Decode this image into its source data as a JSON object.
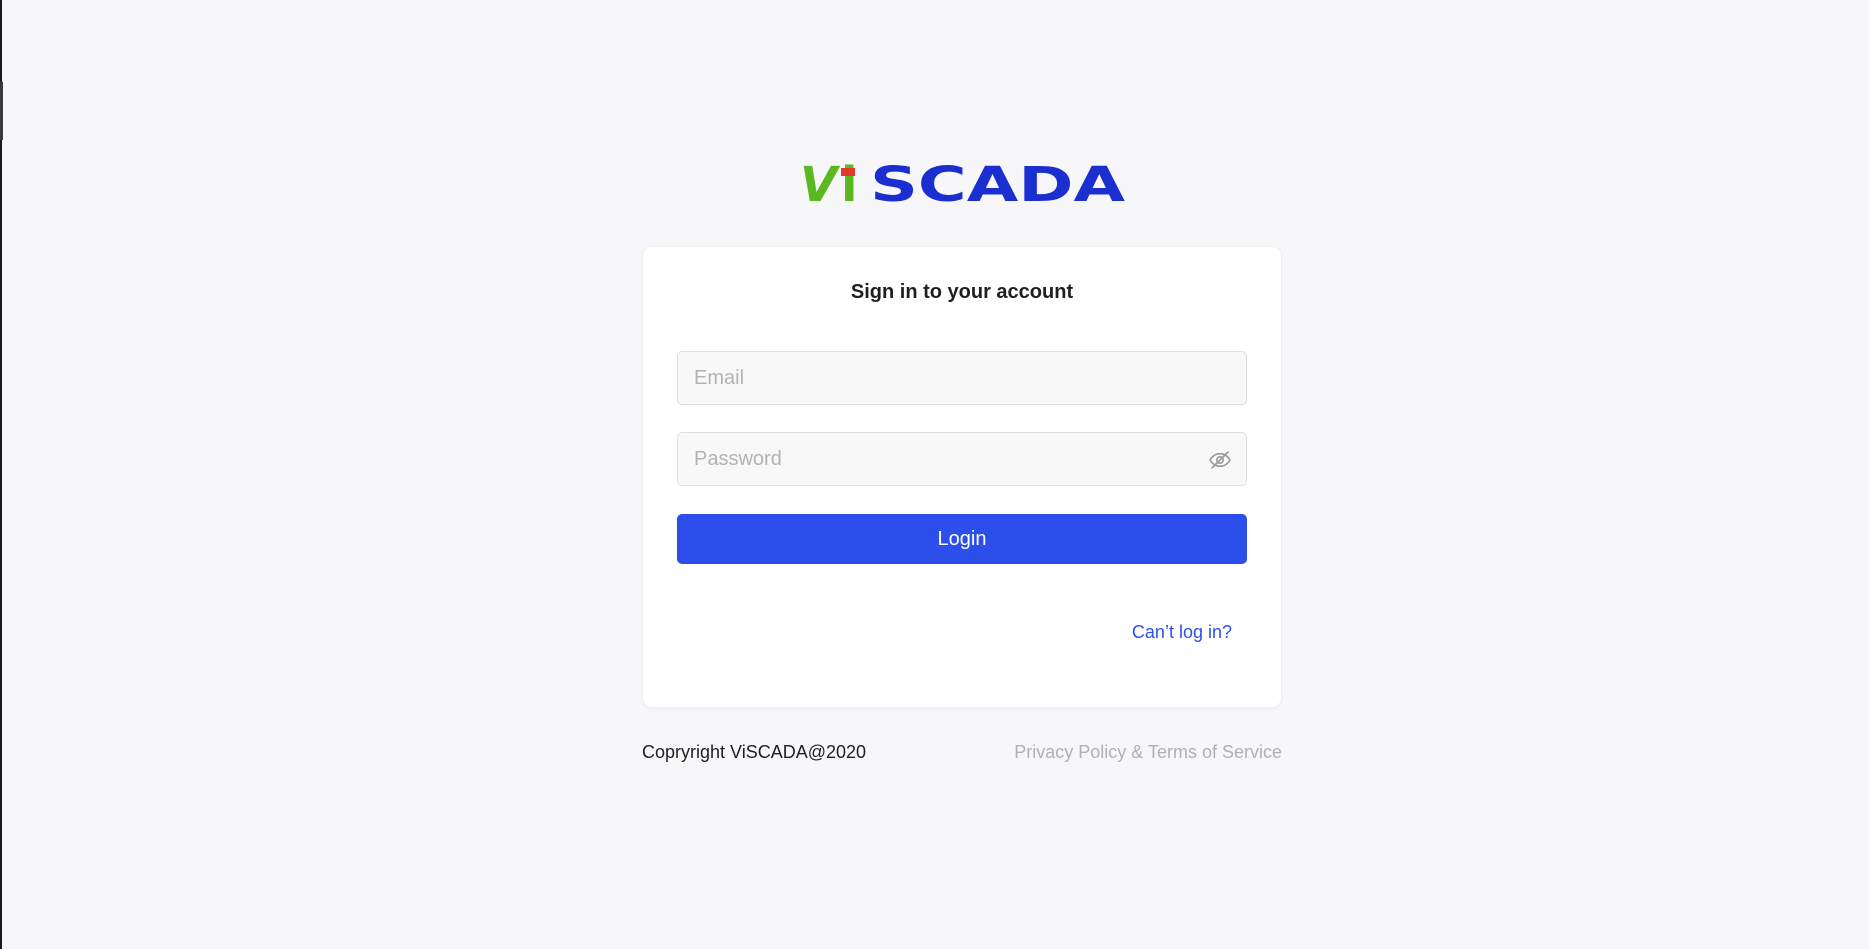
{
  "brand": {
    "logo_text_vi_v": "V",
    "logo_text_vi_i": "i",
    "logo_text_rest": "SCADA",
    "colors": {
      "green": "#5cb81f",
      "red": "#e23a2a",
      "blue": "#1b2fd1"
    }
  },
  "form": {
    "title": "Sign in to your account",
    "email_placeholder": "Email",
    "email_value": "",
    "password_placeholder": "Password",
    "password_value": "",
    "password_toggle_icon": "eye-off-icon",
    "login_label": "Login",
    "cant_login_label": "Can’t log in?"
  },
  "footer": {
    "copyright": "Copryright ViSCADA@2020",
    "privacy_link": "Privacy Policy & Terms of Service"
  },
  "theme": {
    "accent": "#2c4fec",
    "background": "#f7f7f9"
  }
}
